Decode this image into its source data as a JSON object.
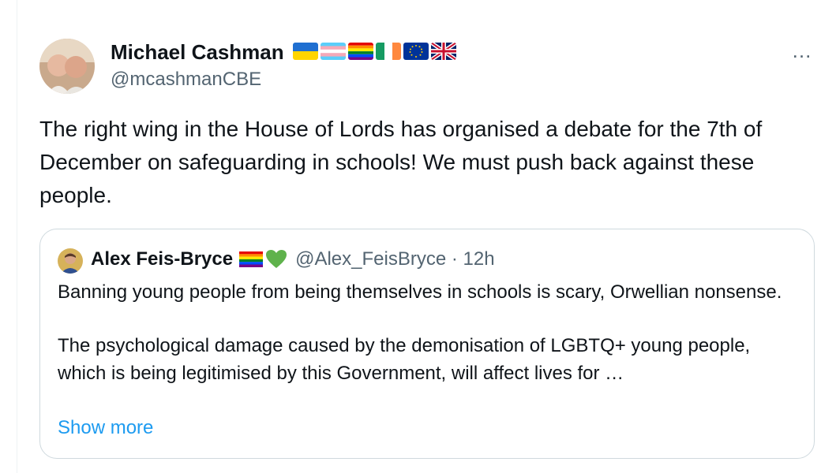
{
  "tweet": {
    "author": {
      "display_name": "Michael Cashman",
      "handle": "@mcashmanCBE",
      "avatar_icon": "two-men-avatar",
      "flags": [
        "ukraine-flag-icon",
        "transgender-flag-icon",
        "rainbow-flag-icon",
        "ireland-flag-icon",
        "eu-flag-icon",
        "uk-flag-icon"
      ]
    },
    "more_icon": "…",
    "text": "The right wing in the House of Lords has organised a debate for the 7th of December on safeguarding in schools! We must push back against these people."
  },
  "quote": {
    "author": {
      "display_name": "Alex Feis-Bryce",
      "handle": "@Alex_FeisBryce",
      "separator": "·",
      "time": "12h",
      "avatar_icon": "man-avatar",
      "emojis": [
        "rainbow-flag-icon",
        "green-heart-icon"
      ]
    },
    "paragraph_1": "Banning young people from being themselves in schools is scary, Orwellian nonsense.",
    "paragraph_2": "The psychological damage caused by the demonisation of LGBTQ+ young people, which is being legitimised by this Government, will affect lives for …",
    "show_more_label": "Show more"
  },
  "colors": {
    "text": "#0f1419",
    "secondary": "#536471",
    "link": "#1d9bf0",
    "border": "#cfd9de"
  }
}
